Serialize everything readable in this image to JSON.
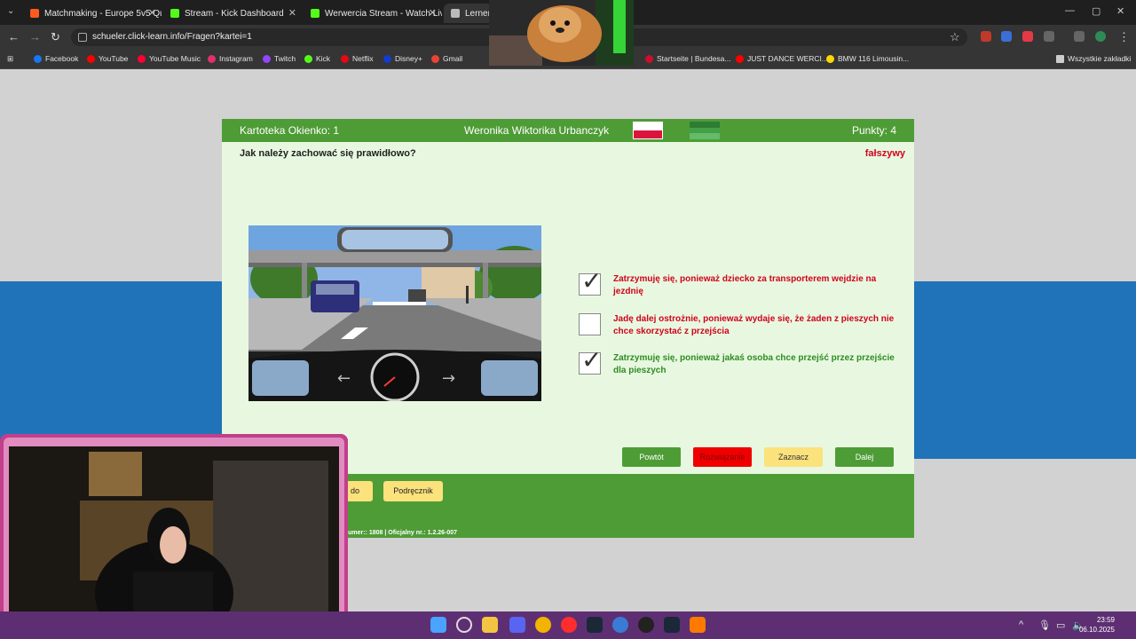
{
  "browser": {
    "tabs": [
      {
        "title": "Matchmaking - Europe 5v5 Qu",
        "icon_color": "#ff5a1f"
      },
      {
        "title": "Stream - Kick Dashboard",
        "icon_color": "#53fc18"
      },
      {
        "title": "Werwercia Stream - Watch Live",
        "icon_color": "#53fc18"
      },
      {
        "title": "Lernen",
        "icon_color": "#bbbbbb"
      }
    ],
    "url": "schueler.click-learn.info/Fragen?kartei=1",
    "bookmarks": [
      {
        "label": "Facebook",
        "color": "#1877f2"
      },
      {
        "label": "YouTube",
        "color": "#ff0000"
      },
      {
        "label": "YouTube Music",
        "color": "#ff0033"
      },
      {
        "label": "Instagram",
        "color": "#e1306c"
      },
      {
        "label": "Twitch",
        "color": "#9146ff"
      },
      {
        "label": "Kick",
        "color": "#53fc18"
      },
      {
        "label": "Netflix",
        "color": "#e50914"
      },
      {
        "label": "Disney+",
        "color": "#113ccf"
      },
      {
        "label": "Gmail",
        "color": "#ea4335"
      },
      {
        "label": "Startseite | Bundesa...",
        "color": "#c8102e"
      },
      {
        "label": "JUST DANCE WERCI...",
        "color": "#ff0000"
      },
      {
        "label": "BMW 116 Limousin...",
        "color": "#ffd700"
      },
      {
        "label": "Wszystkie zakładki",
        "color": "#cccccc"
      }
    ]
  },
  "app": {
    "header_left": "Kartoteka Okienko: 1",
    "student_name": "Weronika Wiktorika Urbanczyk",
    "points": "Punkty: 4",
    "question": "Jak należy zachować się prawidłowo?",
    "verdict": "fałszywy",
    "answers": [
      {
        "text": "Zatrzymuję się, ponieważ dziecko za transporterem wejdzie na jezdnię",
        "checked": true,
        "color": "#d0021b"
      },
      {
        "text": "Jadę dalej ostrożnie, ponieważ wydaje się, że żaden z pieszych nie chce skorzystać z przejścia",
        "checked": false,
        "color": "#d0021b"
      },
      {
        "text": "Zatrzymuję się, ponieważ jakaś osoba chce przejść przez przejście dla pieszych",
        "checked": true,
        "color": "#2e8b22"
      }
    ],
    "buttons": {
      "repeat": "Powtót",
      "solution": "Rozwiązanie",
      "mark": "Zaznacz",
      "next": "Dalej"
    },
    "footer_buttons": {
      "partial": "do",
      "handbook": "Podręcznik"
    },
    "footer_text": "e numer:: 1808 | Oficjalny nr.: 1.2.26-007"
  },
  "taskbar": {
    "time": "23:59",
    "date": "06.10.2025"
  }
}
